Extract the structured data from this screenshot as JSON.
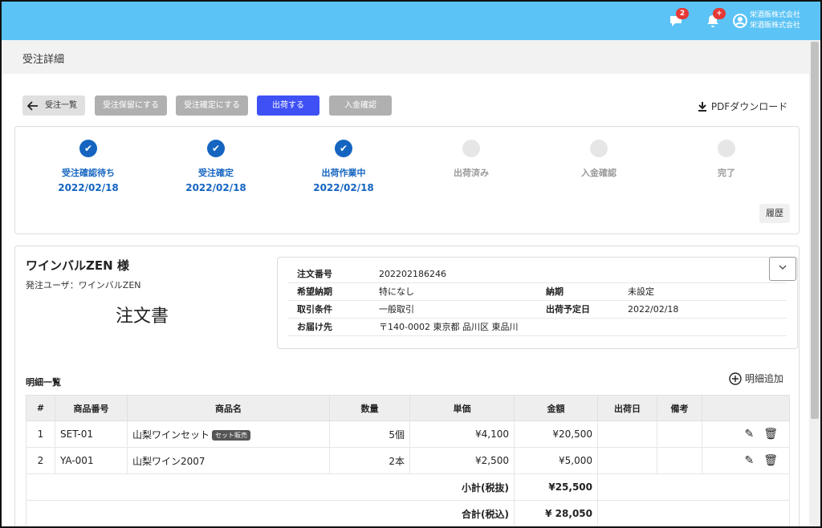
{
  "header": {
    "chat_badge": "2",
    "bell_badge": "+",
    "company_line1": "栄酒販株式会社",
    "company_line2": "栄酒販株式会社"
  },
  "page": {
    "title": "受注詳細"
  },
  "toolbar": {
    "back": "受注一覧",
    "hold": "受注保留にする",
    "confirm": "受注確定にする",
    "ship": "出荷する",
    "payment": "入金確認",
    "pdf": "PDFダウンロード"
  },
  "steps": [
    {
      "label": "受注確認待ち",
      "date": "2022/02/18",
      "done": true
    },
    {
      "label": "受注確定",
      "date": "2022/02/18",
      "done": true
    },
    {
      "label": "出荷作業中",
      "date": "2022/02/18",
      "done": true
    },
    {
      "label": "出荷済み",
      "date": "",
      "done": false
    },
    {
      "label": "入金確認",
      "date": "",
      "done": false
    },
    {
      "label": "完了",
      "date": "",
      "done": false
    }
  ],
  "history_label": "履歴",
  "customer": {
    "name": "ワインバルZEN 様",
    "user": "発注ユーザ：ワインバルZEN",
    "doc_title": "注文書"
  },
  "order": {
    "no_label": "注文番号",
    "no": "202202186246",
    "desired_label": "希望納期",
    "desired": "特になし",
    "due_label": "納期",
    "due": "未設定",
    "terms_label": "取引条件",
    "terms": "一般取引",
    "ship_date_label": "出荷予定日",
    "ship_date": "2022/02/18",
    "dest_label": "お届け先",
    "dest": "〒140-0002  東京都 品川区 東品川"
  },
  "lines": {
    "title": "明細一覧",
    "add_label": "明細追加",
    "headers": [
      "#",
      "商品番号",
      "商品名",
      "数量",
      "単価",
      "金額",
      "出荷日",
      "備考"
    ],
    "rows": [
      {
        "no": "1",
        "code": "SET-01",
        "name": "山梨ワインセット",
        "tag": "セット販売",
        "qty": "5個",
        "price": "¥4,100",
        "amount": "¥20,500",
        "ship": "",
        "note": ""
      },
      {
        "no": "2",
        "code": "YA-001",
        "name": "山梨ワイン2007",
        "tag": "",
        "qty": "2本",
        "price": "¥2,500",
        "amount": "¥5,000",
        "ship": "",
        "note": ""
      }
    ],
    "subtotal_label": "小計(税抜)",
    "subtotal": "¥25,500",
    "total_label": "合計(税込)",
    "total": "¥ 28,050"
  }
}
